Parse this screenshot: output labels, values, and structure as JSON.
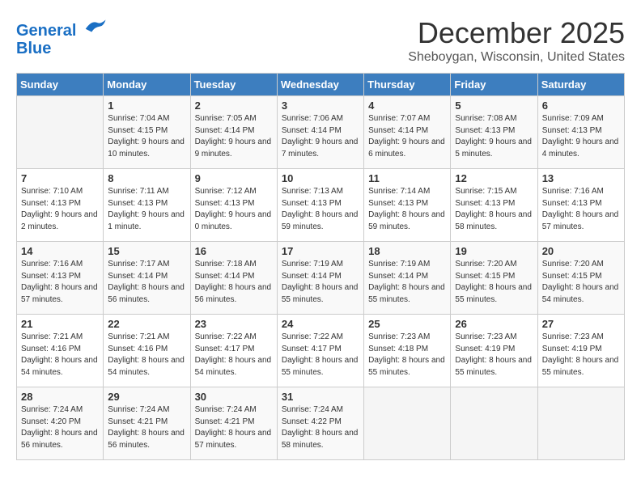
{
  "header": {
    "logo_line1": "General",
    "logo_line2": "Blue",
    "month_title": "December 2025",
    "location": "Sheboygan, Wisconsin, United States"
  },
  "days_of_week": [
    "Sunday",
    "Monday",
    "Tuesday",
    "Wednesday",
    "Thursday",
    "Friday",
    "Saturday"
  ],
  "weeks": [
    [
      {
        "day": "",
        "sunrise": "",
        "sunset": "",
        "daylight": ""
      },
      {
        "day": "1",
        "sunrise": "Sunrise: 7:04 AM",
        "sunset": "Sunset: 4:15 PM",
        "daylight": "Daylight: 9 hours and 10 minutes."
      },
      {
        "day": "2",
        "sunrise": "Sunrise: 7:05 AM",
        "sunset": "Sunset: 4:14 PM",
        "daylight": "Daylight: 9 hours and 9 minutes."
      },
      {
        "day": "3",
        "sunrise": "Sunrise: 7:06 AM",
        "sunset": "Sunset: 4:14 PM",
        "daylight": "Daylight: 9 hours and 7 minutes."
      },
      {
        "day": "4",
        "sunrise": "Sunrise: 7:07 AM",
        "sunset": "Sunset: 4:14 PM",
        "daylight": "Daylight: 9 hours and 6 minutes."
      },
      {
        "day": "5",
        "sunrise": "Sunrise: 7:08 AM",
        "sunset": "Sunset: 4:13 PM",
        "daylight": "Daylight: 9 hours and 5 minutes."
      },
      {
        "day": "6",
        "sunrise": "Sunrise: 7:09 AM",
        "sunset": "Sunset: 4:13 PM",
        "daylight": "Daylight: 9 hours and 4 minutes."
      }
    ],
    [
      {
        "day": "7",
        "sunrise": "Sunrise: 7:10 AM",
        "sunset": "Sunset: 4:13 PM",
        "daylight": "Daylight: 9 hours and 2 minutes."
      },
      {
        "day": "8",
        "sunrise": "Sunrise: 7:11 AM",
        "sunset": "Sunset: 4:13 PM",
        "daylight": "Daylight: 9 hours and 1 minute."
      },
      {
        "day": "9",
        "sunrise": "Sunrise: 7:12 AM",
        "sunset": "Sunset: 4:13 PM",
        "daylight": "Daylight: 9 hours and 0 minutes."
      },
      {
        "day": "10",
        "sunrise": "Sunrise: 7:13 AM",
        "sunset": "Sunset: 4:13 PM",
        "daylight": "Daylight: 8 hours and 59 minutes."
      },
      {
        "day": "11",
        "sunrise": "Sunrise: 7:14 AM",
        "sunset": "Sunset: 4:13 PM",
        "daylight": "Daylight: 8 hours and 59 minutes."
      },
      {
        "day": "12",
        "sunrise": "Sunrise: 7:15 AM",
        "sunset": "Sunset: 4:13 PM",
        "daylight": "Daylight: 8 hours and 58 minutes."
      },
      {
        "day": "13",
        "sunrise": "Sunrise: 7:16 AM",
        "sunset": "Sunset: 4:13 PM",
        "daylight": "Daylight: 8 hours and 57 minutes."
      }
    ],
    [
      {
        "day": "14",
        "sunrise": "Sunrise: 7:16 AM",
        "sunset": "Sunset: 4:13 PM",
        "daylight": "Daylight: 8 hours and 57 minutes."
      },
      {
        "day": "15",
        "sunrise": "Sunrise: 7:17 AM",
        "sunset": "Sunset: 4:14 PM",
        "daylight": "Daylight: 8 hours and 56 minutes."
      },
      {
        "day": "16",
        "sunrise": "Sunrise: 7:18 AM",
        "sunset": "Sunset: 4:14 PM",
        "daylight": "Daylight: 8 hours and 56 minutes."
      },
      {
        "day": "17",
        "sunrise": "Sunrise: 7:19 AM",
        "sunset": "Sunset: 4:14 PM",
        "daylight": "Daylight: 8 hours and 55 minutes."
      },
      {
        "day": "18",
        "sunrise": "Sunrise: 7:19 AM",
        "sunset": "Sunset: 4:14 PM",
        "daylight": "Daylight: 8 hours and 55 minutes."
      },
      {
        "day": "19",
        "sunrise": "Sunrise: 7:20 AM",
        "sunset": "Sunset: 4:15 PM",
        "daylight": "Daylight: 8 hours and 55 minutes."
      },
      {
        "day": "20",
        "sunrise": "Sunrise: 7:20 AM",
        "sunset": "Sunset: 4:15 PM",
        "daylight": "Daylight: 8 hours and 54 minutes."
      }
    ],
    [
      {
        "day": "21",
        "sunrise": "Sunrise: 7:21 AM",
        "sunset": "Sunset: 4:16 PM",
        "daylight": "Daylight: 8 hours and 54 minutes."
      },
      {
        "day": "22",
        "sunrise": "Sunrise: 7:21 AM",
        "sunset": "Sunset: 4:16 PM",
        "daylight": "Daylight: 8 hours and 54 minutes."
      },
      {
        "day": "23",
        "sunrise": "Sunrise: 7:22 AM",
        "sunset": "Sunset: 4:17 PM",
        "daylight": "Daylight: 8 hours and 54 minutes."
      },
      {
        "day": "24",
        "sunrise": "Sunrise: 7:22 AM",
        "sunset": "Sunset: 4:17 PM",
        "daylight": "Daylight: 8 hours and 55 minutes."
      },
      {
        "day": "25",
        "sunrise": "Sunrise: 7:23 AM",
        "sunset": "Sunset: 4:18 PM",
        "daylight": "Daylight: 8 hours and 55 minutes."
      },
      {
        "day": "26",
        "sunrise": "Sunrise: 7:23 AM",
        "sunset": "Sunset: 4:19 PM",
        "daylight": "Daylight: 8 hours and 55 minutes."
      },
      {
        "day": "27",
        "sunrise": "Sunrise: 7:23 AM",
        "sunset": "Sunset: 4:19 PM",
        "daylight": "Daylight: 8 hours and 55 minutes."
      }
    ],
    [
      {
        "day": "28",
        "sunrise": "Sunrise: 7:24 AM",
        "sunset": "Sunset: 4:20 PM",
        "daylight": "Daylight: 8 hours and 56 minutes."
      },
      {
        "day": "29",
        "sunrise": "Sunrise: 7:24 AM",
        "sunset": "Sunset: 4:21 PM",
        "daylight": "Daylight: 8 hours and 56 minutes."
      },
      {
        "day": "30",
        "sunrise": "Sunrise: 7:24 AM",
        "sunset": "Sunset: 4:21 PM",
        "daylight": "Daylight: 8 hours and 57 minutes."
      },
      {
        "day": "31",
        "sunrise": "Sunrise: 7:24 AM",
        "sunset": "Sunset: 4:22 PM",
        "daylight": "Daylight: 8 hours and 58 minutes."
      },
      {
        "day": "",
        "sunrise": "",
        "sunset": "",
        "daylight": ""
      },
      {
        "day": "",
        "sunrise": "",
        "sunset": "",
        "daylight": ""
      },
      {
        "day": "",
        "sunrise": "",
        "sunset": "",
        "daylight": ""
      }
    ]
  ]
}
